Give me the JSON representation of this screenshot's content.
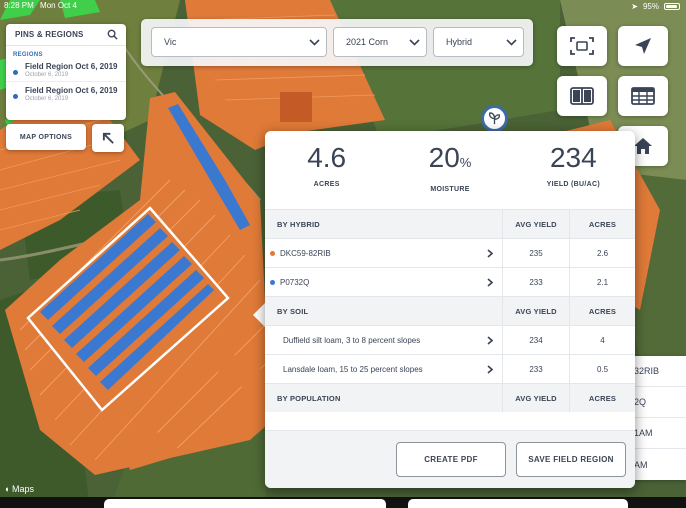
{
  "status_bar": {
    "time": "8:28 PM",
    "date": "Mon Oct 4",
    "battery": "95%"
  },
  "pins_panel": {
    "title": "PINS & REGIONS",
    "section_label": "REGIONS",
    "regions": [
      {
        "name": "Field Region Oct 6, 2019",
        "date": "October 6, 2019"
      },
      {
        "name": "Field Region Oct 6, 2019",
        "date": "October 6, 2019"
      }
    ]
  },
  "map_options_label": "MAP OPTIONS",
  "filters": {
    "location": "Vic",
    "season": "2021 Corn",
    "type": "Hybrid"
  },
  "stats": {
    "acres": {
      "value": "4.6",
      "label": "ACRES"
    },
    "moisture": {
      "value": "20",
      "unit": "%",
      "label": "MOISTURE"
    },
    "yield": {
      "value": "234",
      "label": "YIELD (BU/AC)"
    }
  },
  "table": {
    "hybrid_section": {
      "title": "BY HYBRID",
      "col2": "AVG YIELD",
      "col3": "ACRES"
    },
    "hybrids": [
      {
        "name": "DKC59-82RIB",
        "avg_yield": "235",
        "acres": "2.6",
        "color": "#e07a38"
      },
      {
        "name": "P0732Q",
        "avg_yield": "233",
        "acres": "2.1",
        "color": "#3b78d0"
      }
    ],
    "soil_section": {
      "title": "BY SOIL",
      "col2": "AVG YIELD",
      "col3": "ACRES"
    },
    "soils": [
      {
        "name": "Duffield silt loam, 3 to 8 percent slopes",
        "avg_yield": "234",
        "acres": "4"
      },
      {
        "name": "Lansdale loam, 15 to 25 percent slopes",
        "avg_yield": "233",
        "acres": "0.5"
      }
    ],
    "population_section": {
      "title": "BY POPULATION",
      "col2": "AVG YIELD",
      "col3": "ACRES"
    }
  },
  "buttons": {
    "create_pdf": "CREATE PDF",
    "save_region": "SAVE FIELD REGION"
  },
  "right_list": [
    "32RIB",
    "2Q",
    "1AM",
    "AM"
  ],
  "maps_attribution": "Maps",
  "colors": {
    "accent_blue": "#2e6db8",
    "field_orange": "#e07a38",
    "planting_blue": "#3b78d0",
    "green_strip": "#3fcf4a"
  }
}
